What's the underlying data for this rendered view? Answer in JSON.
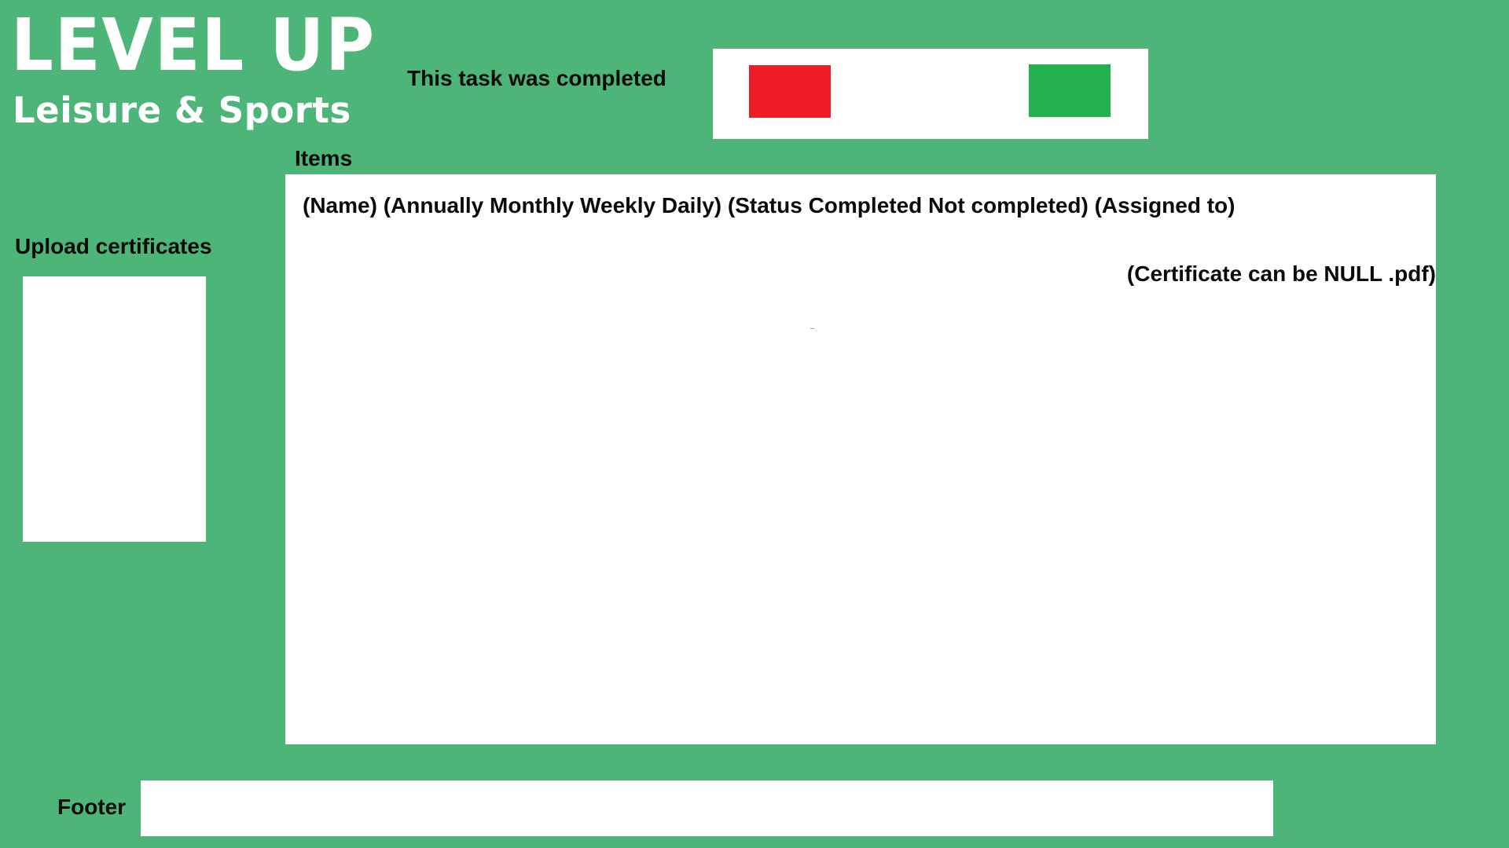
{
  "colors": {
    "background": "#4cb577",
    "panel": "#ffffff",
    "not_completed_button": "#ee1c25",
    "completed_button": "#23b14d"
  },
  "logo": {
    "line1": "LEVEL UP",
    "line2": "Leisure & Sports"
  },
  "task_status": {
    "label": "This task was completed"
  },
  "items": {
    "heading": "Items",
    "header_text": "(Name) (Annually Monthly Weekly Daily) (Status Completed Not completed) (Assigned to)",
    "certificate_note": "(Certificate can be NULL .pdf)"
  },
  "upload": {
    "label": "Upload certificates"
  },
  "footer": {
    "label": "Footer"
  }
}
